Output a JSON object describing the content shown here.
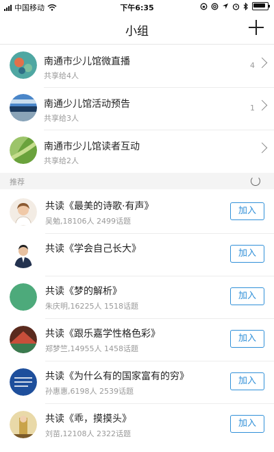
{
  "status": {
    "carrier": "中国移动",
    "time": "下午6:35"
  },
  "nav": {
    "title": "小组"
  },
  "groups": [
    {
      "name": "南通市少儿馆微直播",
      "sub": "共享给4人",
      "count": "4"
    },
    {
      "name": "南通少儿馆活动预告",
      "sub": "共享给3人",
      "count": "1"
    },
    {
      "name": "南通市少儿馆读者互动",
      "sub": "共享给2人",
      "count": ""
    }
  ],
  "section": {
    "label": "推荐"
  },
  "recommended": [
    {
      "title": "共读《最美的诗歌·有声》",
      "meta": "吴勉,18106人 2499话题",
      "join": "加入"
    },
    {
      "title": "共读《学会自己长大》",
      "meta": "",
      "join": "加入"
    },
    {
      "title": "共读《梦的解析》",
      "meta": "朱庆明,16225人 1518话题",
      "join": "加入"
    },
    {
      "title": "共读《跟乐嘉学性格色彩》",
      "meta": "郑梦竺,14955人 1458话题",
      "join": "加入"
    },
    {
      "title": "共读《为什么有的国家富有的穷》",
      "meta": "孙惠惠,6198人 2539话题",
      "join": "加入"
    },
    {
      "title": "共读《乖，摸摸头》",
      "meta": "刘苗,12108人 2322话题",
      "join": "加入"
    }
  ]
}
